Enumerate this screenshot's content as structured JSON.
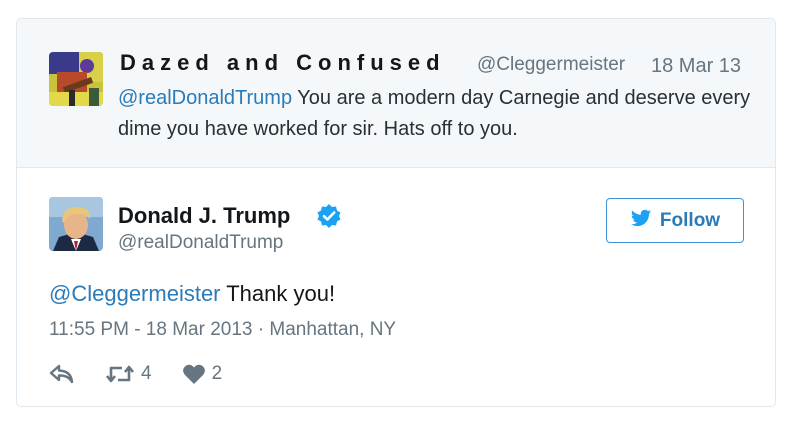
{
  "quoted_tweet": {
    "display_name": "Dazed and Confused",
    "handle": "@Cleggermeister",
    "date": "18 Mar 13",
    "mention": "@realDonaldTrump",
    "text": " You are a modern day Carnegie and deserve every dime you have worked for sir. Hats off to you.",
    "avatar_icon": "guitarist-photo-avatar"
  },
  "tweet": {
    "display_name": "Donald J. Trump",
    "handle": "@realDonaldTrump",
    "verified_icon": "verified-badge-icon",
    "avatar_icon": "profile-photo-avatar",
    "mention": "@Cleggermeister",
    "text": " Thank you!",
    "meta": "11:55 PM - 18 Mar 2013 · Manhattan, NY"
  },
  "follow_button": {
    "label": "Follow",
    "icon": "twitter-bird-icon"
  },
  "actions": {
    "reply_icon": "reply-icon",
    "retweet_icon": "retweet-icon",
    "retweet_count": "4",
    "like_icon": "heart-icon",
    "like_count": "2"
  },
  "colors": {
    "link": "#2b7bb9",
    "muted": "#66757f",
    "quoted_background": "#f5f8fa",
    "border": "#e1e8ed",
    "verified": "#1da1f2"
  }
}
